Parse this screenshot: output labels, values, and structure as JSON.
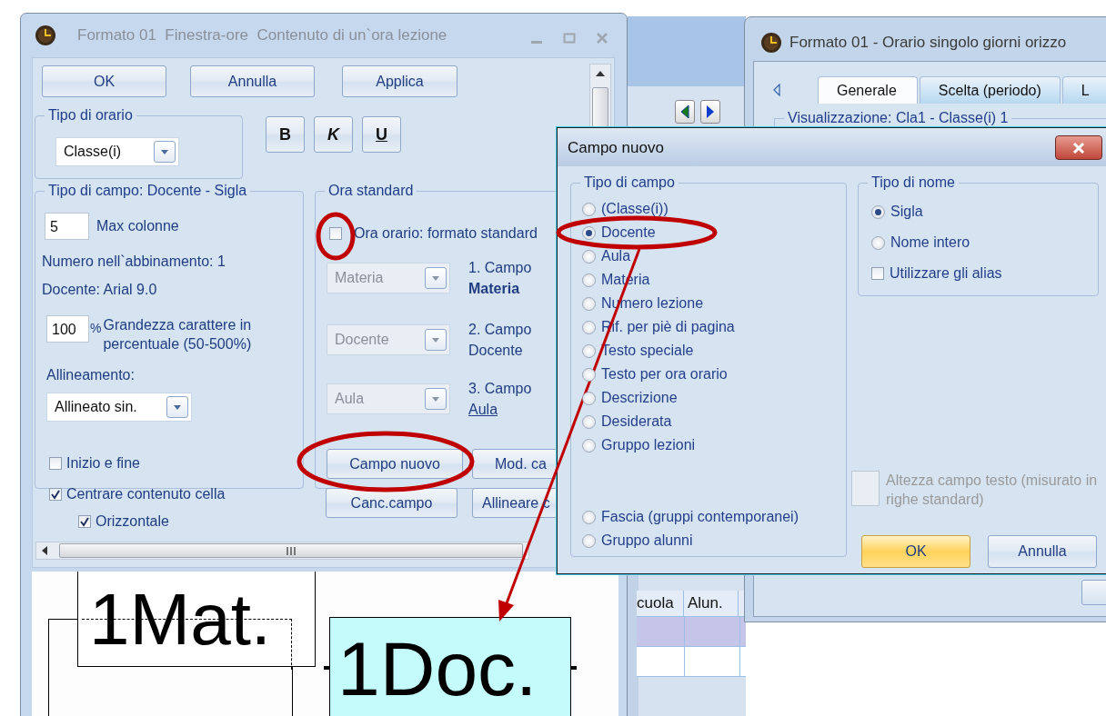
{
  "left_window": {
    "title": "Formato 01  Finestra-ore  Contenuto di un`ora lezione",
    "top_buttons": [
      "OK",
      "Annulla",
      "Applica"
    ],
    "schedule_type": {
      "label": "Tipo di orario",
      "value": "Classe(i)"
    },
    "style_buttons": [
      {
        "label": "B",
        "kind": "bold"
      },
      {
        "label": "K",
        "kind": "italic"
      },
      {
        "label": "U",
        "kind": "underline"
      }
    ],
    "field_group": {
      "label": "Tipo di campo: Docente - Sigla",
      "max_columns": {
        "value": "5",
        "label": "Max colonne"
      },
      "info": [
        "Numero nell`abbinamento: 1",
        "Docente: Arial 9.0"
      ],
      "size": {
        "value": "100",
        "unit": "%",
        "label": "Grandezza carattere in percentuale (50-500%)"
      },
      "alignment": {
        "label": "Allineamento:",
        "value": "Allineato sin."
      }
    },
    "standard_group": {
      "label": "Ora standard",
      "standard_format": {
        "label": "Ora orario: formato standard",
        "checked": false
      },
      "fields": [
        {
          "value": "Materia",
          "number": "1. Campo",
          "name": "Materia",
          "kind": "bold",
          "disabled": true
        },
        {
          "value": "Docente",
          "number": "2. Campo",
          "name": "Docente",
          "kind": "plain",
          "disabled": true
        },
        {
          "value": "Aula",
          "number": "3. Campo",
          "name": "Aula",
          "kind": "link",
          "disabled": true
        }
      ]
    },
    "field_buttons": [
      "Campo nuovo",
      "Mod. ca",
      "Canc.campo",
      "Allineare c"
    ],
    "options": [
      {
        "label": "Inizio e fine",
        "checked": false
      },
      {
        "label": "Centrare contenuto cella",
        "checked": true,
        "children": [
          {
            "label": "Orizzontale",
            "checked": true
          }
        ]
      }
    ],
    "preview": [
      {
        "text": "1Mat.",
        "kind": "plain"
      },
      {
        "text": "1Doc.",
        "kind": "highlighted"
      }
    ]
  },
  "background_table": {
    "columns": [
      "cuola",
      "Alun."
    ]
  },
  "right_window": {
    "title": "Formato 01 - Orario singolo giorni orizzo",
    "tabs": [
      {
        "label": "Generale",
        "selected": true
      },
      {
        "label": "Scelta (periodo)",
        "selected": false
      },
      {
        "label": "L",
        "selected": false
      }
    ],
    "group_label": "Visualizzazione: Cla1 - Classe(i) 1"
  },
  "dialog": {
    "title": "Campo nuovo",
    "field_type": {
      "label": "Tipo di campo",
      "options": [
        {
          "label": "(Classe(i))",
          "selected": false
        },
        {
          "label": "Docente",
          "selected": true
        },
        {
          "label": "Aula",
          "selected": false
        },
        {
          "label": "Materia",
          "selected": false
        },
        {
          "label": "Numero lezione",
          "selected": false
        },
        {
          "label": "Rif. per piè di pagina",
          "selected": false
        },
        {
          "label": "Testo speciale",
          "selected": false
        },
        {
          "label": "Testo per ora orario",
          "selected": false
        },
        {
          "label": "Descrizione",
          "selected": false
        },
        {
          "label": "Desiderata",
          "selected": false
        },
        {
          "label": "Gruppo lezioni",
          "selected": false
        }
      ],
      "more_options": [
        {
          "label": "Fascia (gruppi contemporanei)",
          "selected": false
        },
        {
          "label": "Gruppo alunni",
          "selected": false
        }
      ]
    },
    "name_type": {
      "label": "Tipo di nome",
      "options": [
        {
          "label": "Sigla",
          "selected": true
        },
        {
          "label": "Nome intero",
          "selected": false
        }
      ],
      "alias": {
        "label": "Utilizzare gli alias",
        "checked": false
      }
    },
    "height": {
      "label": "Altezza campo testo (misurato in righe standard)",
      "disabled": true
    },
    "buttons": [
      {
        "label": "OK",
        "default": true
      },
      {
        "label": "Annulla",
        "default": false
      }
    ]
  }
}
